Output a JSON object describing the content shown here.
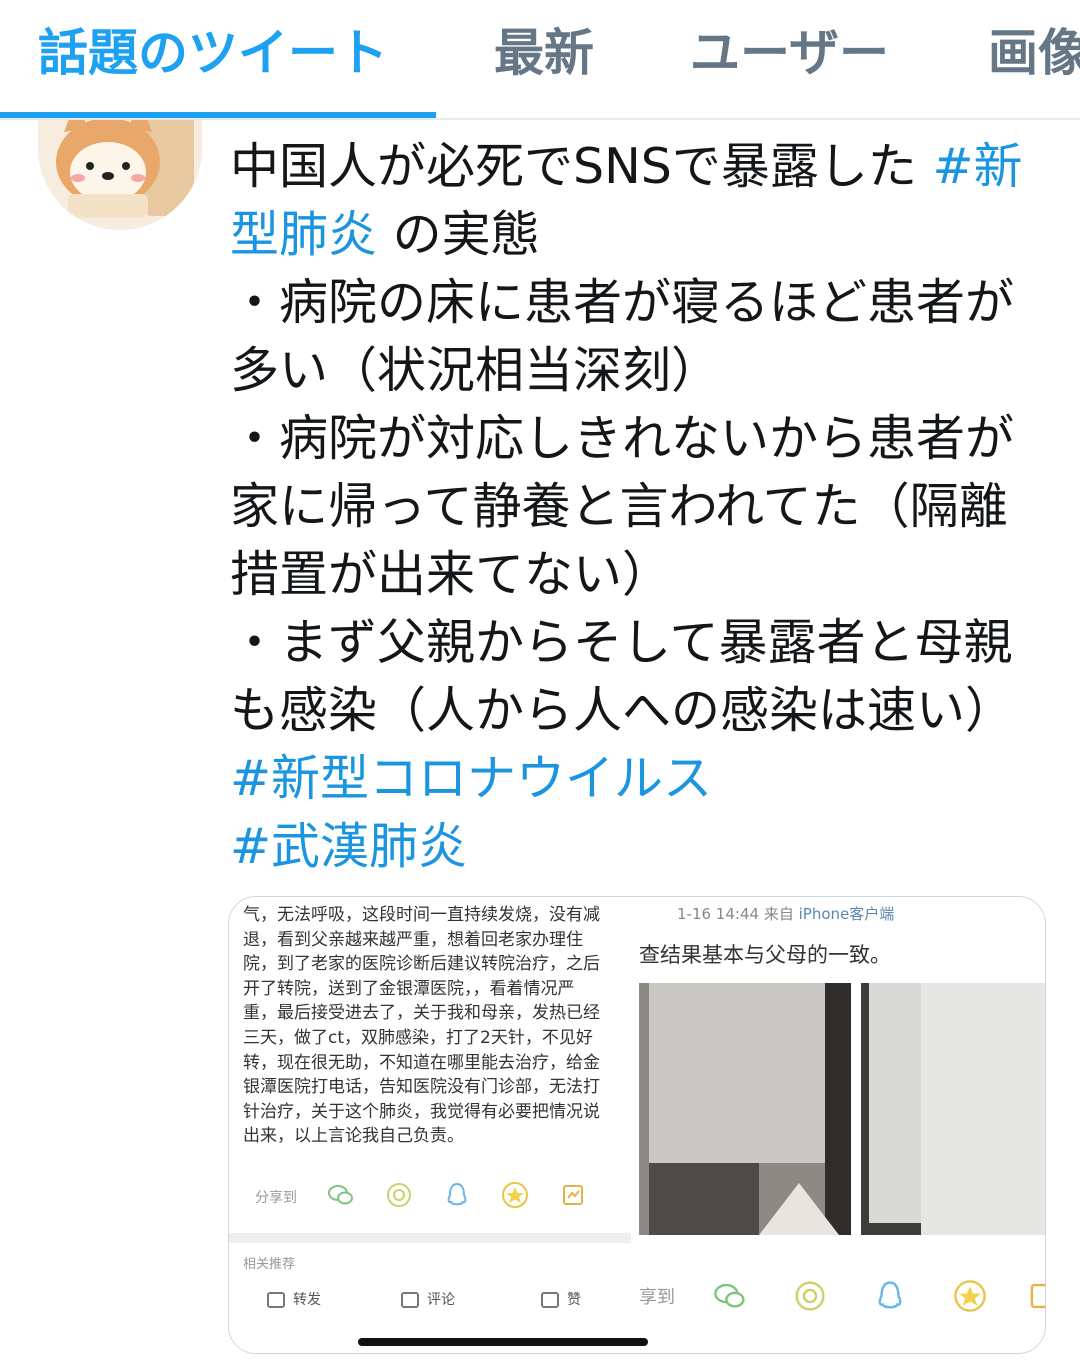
{
  "tabs": [
    {
      "label": "話題のツイート",
      "active": true
    },
    {
      "label": "最新",
      "active": false
    },
    {
      "label": "ユーザー",
      "active": false
    },
    {
      "label": "画像",
      "active": false
    }
  ],
  "tweet": {
    "lines": {
      "l1_text": "中国人が必死でSNSで暴露した ",
      "l1_tag": "#新",
      "l2_tag": "型肺炎",
      "l2_text": " の実態",
      "l3": "・病院の床に患者が寝るほど患者が",
      "l4": "多い（状況相当深刻）",
      "l5": "・病院が対応しきれないから患者が",
      "l6": "家に帰って静養と言われてた（隔離",
      "l7": "措置が出来てない）",
      "l8": "・まず父親からそして暴露者と母親",
      "l9": "も感染（人から人への感染は速い）",
      "l10_tag": "#新型コロナウイルス",
      "l11_tag": "#武漢肺炎"
    }
  },
  "media": {
    "left": {
      "cn_lines": [
        "气，无法呼吸，这段时间一直持续发烧，没有减",
        "退，看到父亲越来越严重，想着回老家办理住",
        "院，到了老家的医院诊断后建议转院治疗，之后",
        "开了转院，送到了金银潭医院，，看着情况严",
        "重，最后接受进去了，关于我和母亲，发热已经",
        "三天，做了ct，双肺感染，打了2天针，不见好",
        "转，现在很无助，不知道在哪里能去治疗，给金",
        "银潭医院打电话，告知医院没有门诊部，无法打",
        "针治疗，关于这个肺炎，我觉得有必要把情况说",
        "出来，以上言论我自己负责。"
      ],
      "share_label": "分享到",
      "related_label": "相关推荐",
      "actions": {
        "forward": "转发",
        "comment": "评论",
        "like": "赞"
      }
    },
    "right": {
      "time": "1-16 14:44",
      "from": "来自",
      "client": "iPhone客户端",
      "result_text": "查结果基本与父母的一致。",
      "share_label": "享到"
    }
  },
  "colors": {
    "accent": "#1da1f2",
    "hashtag": "#1b95e0",
    "tab_inactive": "#657786"
  },
  "icons": [
    "wechat-icon",
    "moments-icon",
    "qq-icon",
    "qzone-star-icon",
    "save-icon"
  ]
}
